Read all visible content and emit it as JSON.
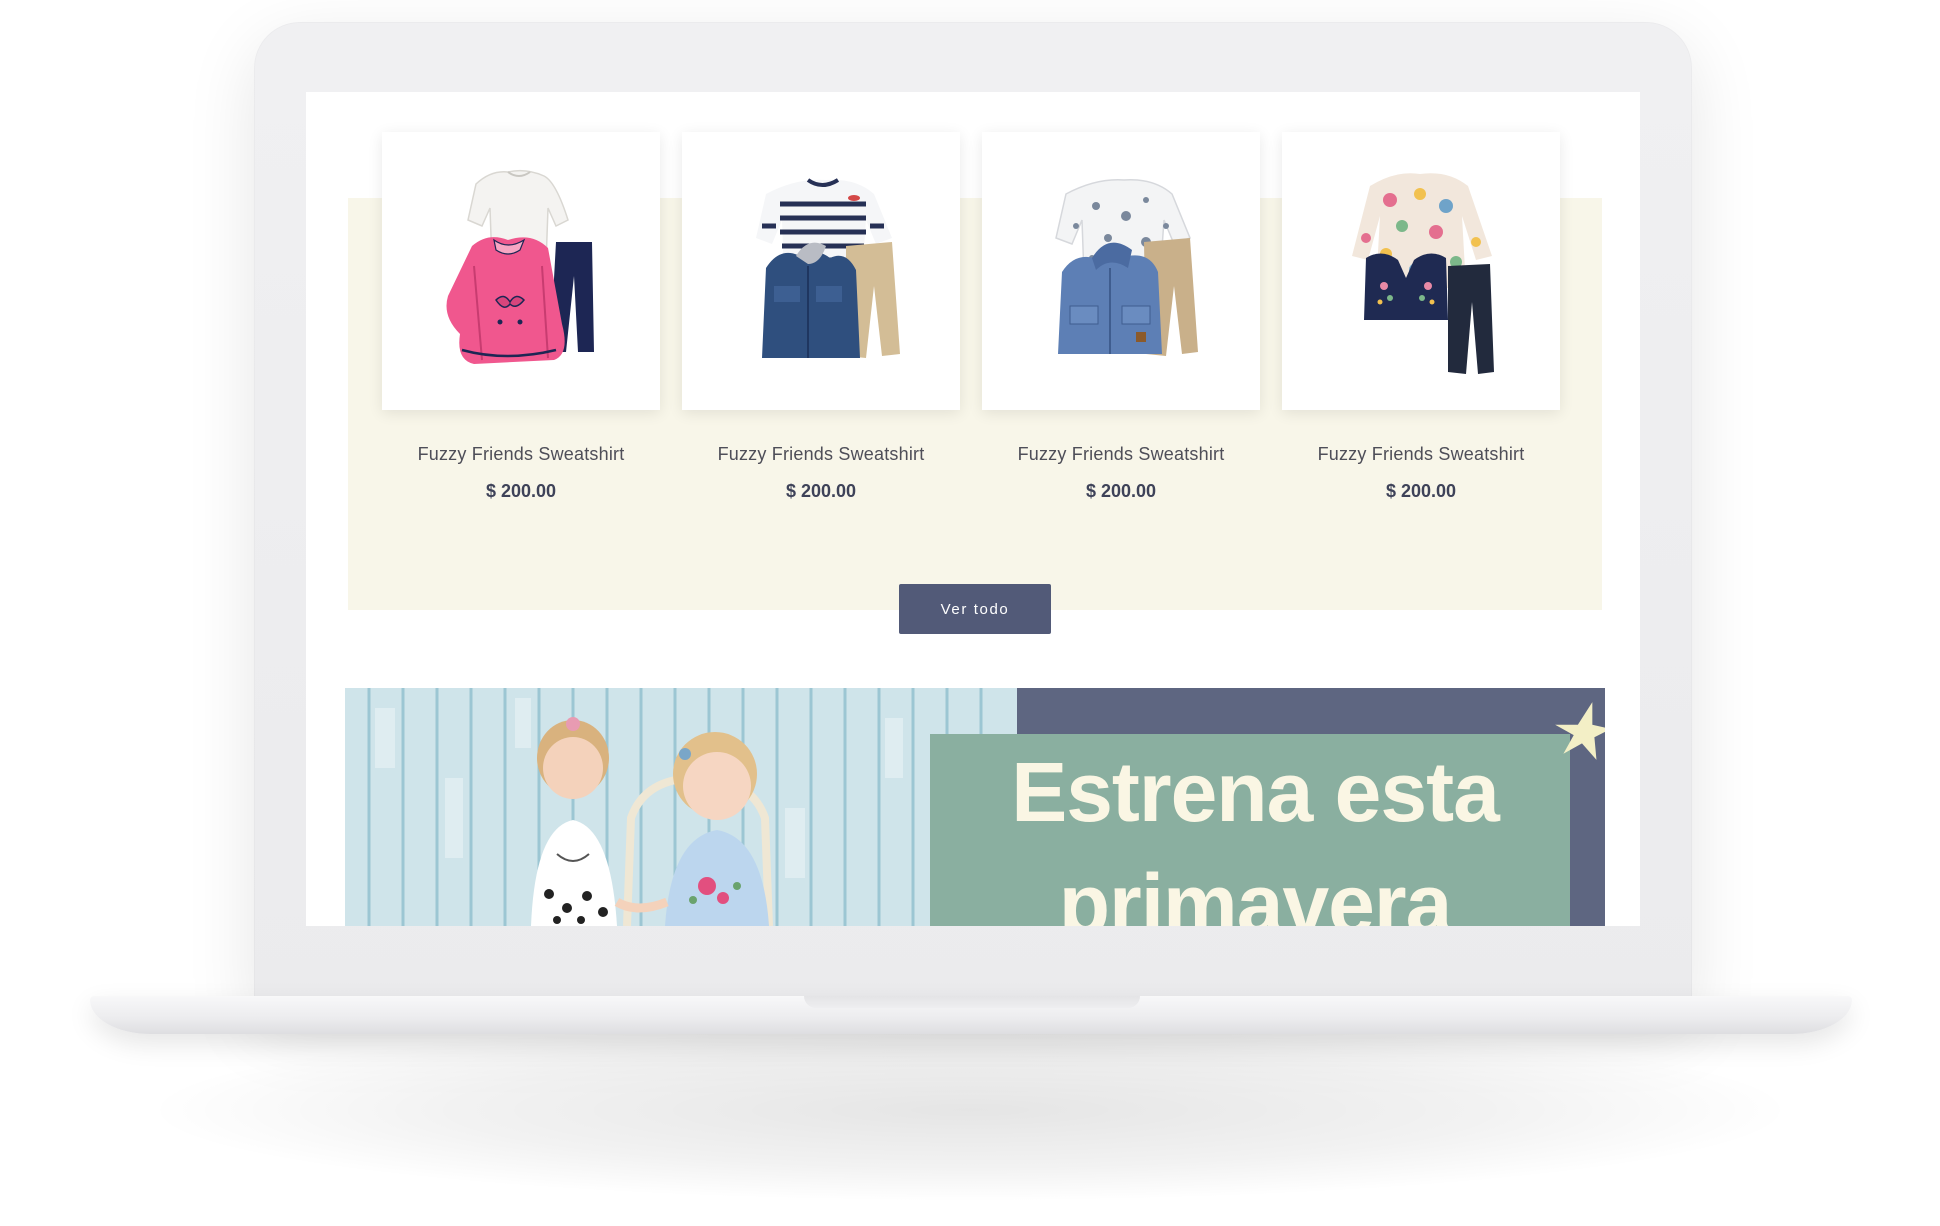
{
  "products": [
    {
      "name": "Fuzzy Friends Sweatshirt",
      "price": "$ 200.00"
    },
    {
      "name": "Fuzzy Friends Sweatshirt",
      "price": "$ 200.00"
    },
    {
      "name": "Fuzzy Friends Sweatshirt",
      "price": "$ 200.00"
    },
    {
      "name": "Fuzzy Friends Sweatshirt",
      "price": "$ 200.00"
    }
  ],
  "view_all_label": "Ver todo",
  "banner": {
    "headline_line1": "Estrena esta",
    "headline_line2": "primavera"
  },
  "colors": {
    "button": "#525a78",
    "cream_band": "#f8f6e9",
    "banner_navy": "#5e6681",
    "banner_green": "#8aafa0",
    "headline_text": "#faf6e4"
  },
  "icons": [
    "star-icon"
  ]
}
